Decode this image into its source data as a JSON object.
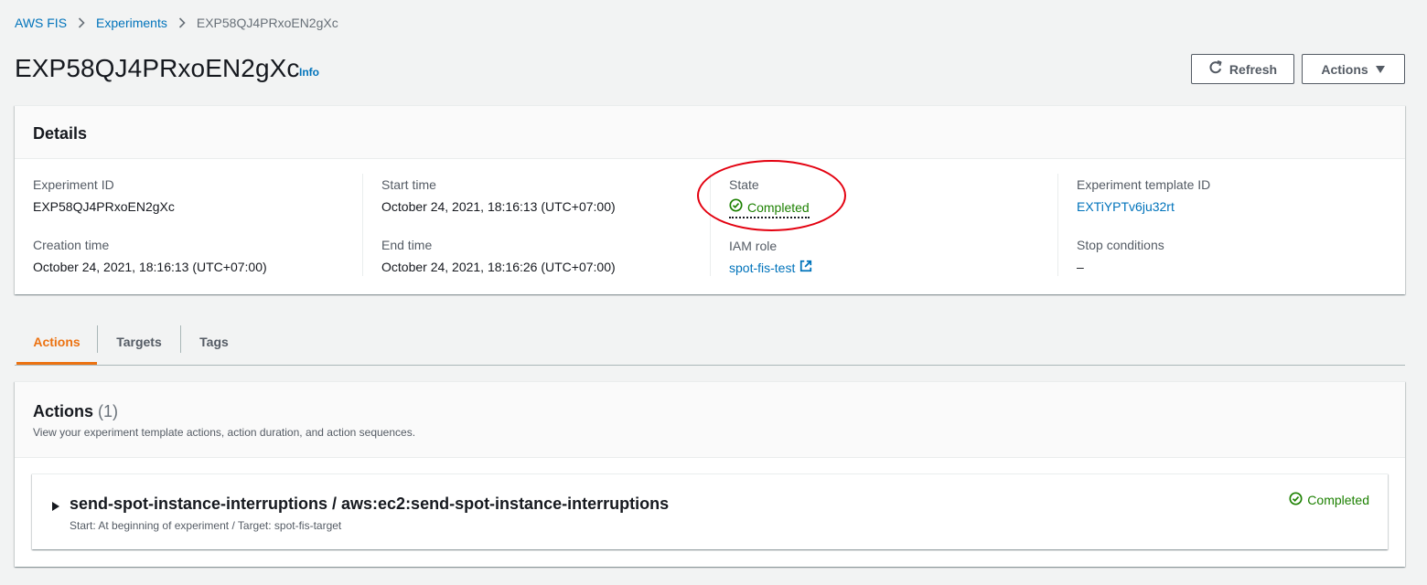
{
  "breadcrumb": {
    "items": [
      {
        "label": "AWS FIS"
      },
      {
        "label": "Experiments"
      },
      {
        "label": "EXP58QJ4PRxoEN2gXc"
      }
    ]
  },
  "header": {
    "title": "EXP58QJ4PRxoEN2gXc",
    "info_label": "Info",
    "refresh_label": "Refresh",
    "actions_label": "Actions"
  },
  "details": {
    "title": "Details",
    "experiment_id_label": "Experiment ID",
    "experiment_id": "EXP58QJ4PRxoEN2gXc",
    "creation_time_label": "Creation time",
    "creation_time": "October 24, 2021, 18:16:13 (UTC+07:00)",
    "start_time_label": "Start time",
    "start_time": "October 24, 2021, 18:16:13 (UTC+07:00)",
    "end_time_label": "End time",
    "end_time": "October 24, 2021, 18:16:26 (UTC+07:00)",
    "state_label": "State",
    "state": "Completed",
    "iam_role_label": "IAM role",
    "iam_role": "spot-fis-test",
    "template_id_label": "Experiment template ID",
    "template_id": "EXTiYPTv6ju32rt",
    "stop_conditions_label": "Stop conditions",
    "stop_conditions": "–"
  },
  "tabs": [
    {
      "label": "Actions",
      "active": true
    },
    {
      "label": "Targets",
      "active": false
    },
    {
      "label": "Tags",
      "active": false
    }
  ],
  "actions_panel": {
    "title": "Actions",
    "count": "(1)",
    "description": "View your experiment template actions, action duration, and action sequences.",
    "items": [
      {
        "name": "send-spot-instance-interruptions / aws:ec2:send-spot-instance-interruptions",
        "subtitle": "Start: At beginning of experiment / Target: spot-fis-target",
        "status": "Completed"
      }
    ]
  },
  "colors": {
    "link": "#0073bb",
    "success": "#1d8102",
    "active_tab": "#ec7211",
    "annotation": "#e3000f"
  }
}
